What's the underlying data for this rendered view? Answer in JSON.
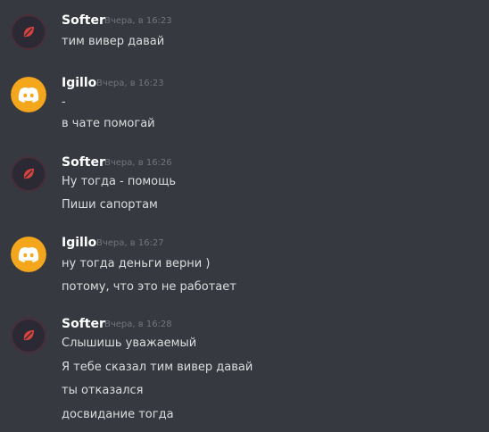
{
  "colors": {
    "background": "#36393f",
    "username": "#ffffff",
    "message_text": "#dcddde",
    "timestamp": "#72767d",
    "softer_avatar_bg": "#2b2a34",
    "softer_avatar_accent": "#d9433f",
    "igillo_avatar_bg": "#f4a71c"
  },
  "groups": [
    {
      "author": "Softer",
      "avatar_icon": "softer-leaf-avatar",
      "timestamp": "Вчера, в 16:23",
      "messages": [
        "тим вивер давай"
      ]
    },
    {
      "author": "Igillo",
      "avatar_icon": "discord-logo-avatar",
      "timestamp": "Вчера, в 16:23",
      "messages": [
        "-",
        "в чате помогай"
      ]
    },
    {
      "author": "Softer",
      "avatar_icon": "softer-leaf-avatar",
      "timestamp": "Вчера, в 16:26",
      "messages": [
        "Ну тогда - помощь",
        "Пиши сапортам"
      ]
    },
    {
      "author": "Igillo",
      "avatar_icon": "discord-logo-avatar",
      "timestamp": "Вчера, в 16:27",
      "messages": [
        "ну тогда деньги верни )",
        "потому, что это не работает"
      ]
    },
    {
      "author": "Softer",
      "avatar_icon": "softer-leaf-avatar",
      "timestamp": "Вчера, в 16:28",
      "messages": [
        "Слышишь уважаемый",
        "Я тебе сказал тим вивер давай",
        "ты отказался",
        "досвидание тогда"
      ]
    }
  ]
}
